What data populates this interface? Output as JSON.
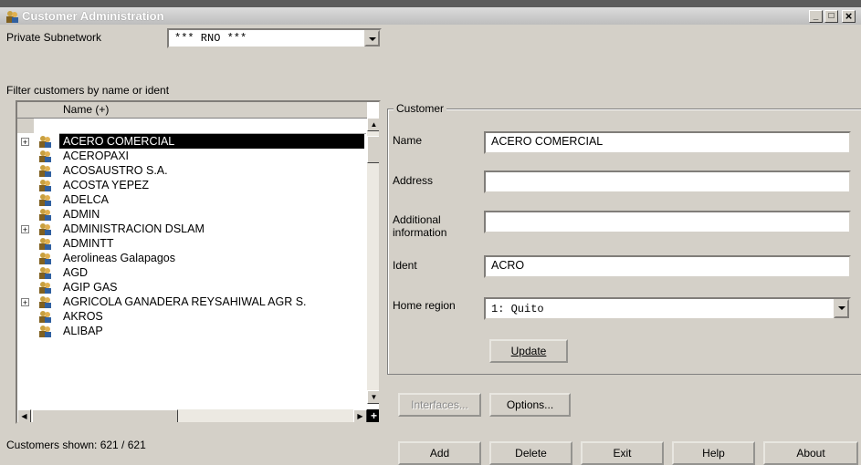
{
  "window": {
    "title": "Customer Administration",
    "min": "_",
    "max": "□",
    "close": "×"
  },
  "subnetwork": {
    "label": "Private Subnetwork",
    "value": "*** RNO ***"
  },
  "filter": {
    "label": "Filter customers by name or ident"
  },
  "list": {
    "column": "Name (+)",
    "rows": [
      {
        "name": "ACERO COMERCIAL",
        "expand": "+",
        "selected": true
      },
      {
        "name": "ACEROPAXI",
        "expand": ""
      },
      {
        "name": "ACOSAUSTRO S.A.",
        "expand": ""
      },
      {
        "name": "ACOSTA YEPEZ",
        "expand": ""
      },
      {
        "name": "ADELCA",
        "expand": ""
      },
      {
        "name": "ADMIN",
        "expand": ""
      },
      {
        "name": "ADMINISTRACION DSLAM",
        "expand": "+"
      },
      {
        "name": "ADMINTT",
        "expand": ""
      },
      {
        "name": "Aerolineas Galapagos",
        "expand": ""
      },
      {
        "name": "AGD",
        "expand": ""
      },
      {
        "name": "AGIP GAS",
        "expand": ""
      },
      {
        "name": "AGRICOLA GANADERA REYSAHIWAL AGR S.",
        "expand": "+"
      },
      {
        "name": "AKROS",
        "expand": ""
      },
      {
        "name": "ALIBAP",
        "expand": ""
      }
    ],
    "corner": "+"
  },
  "status": "Customers shown: 621 / 621",
  "customer": {
    "group_title": "Customer",
    "name_label": "Name",
    "name_value": "ACERO COMERCIAL",
    "address_label": "Address",
    "address_value": "",
    "additional_label_1": "Additional",
    "additional_label_2": "information",
    "additional_value": "",
    "ident_label": "Ident",
    "ident_value": "ACRO",
    "region_label": "Home region",
    "region_value": "1: Quito",
    "update": "Update"
  },
  "buttons": {
    "interfaces": "Interfaces...",
    "options": "Options...",
    "add": "Add",
    "delete": "Delete",
    "exit": "Exit",
    "help": "Help",
    "about": "About"
  }
}
